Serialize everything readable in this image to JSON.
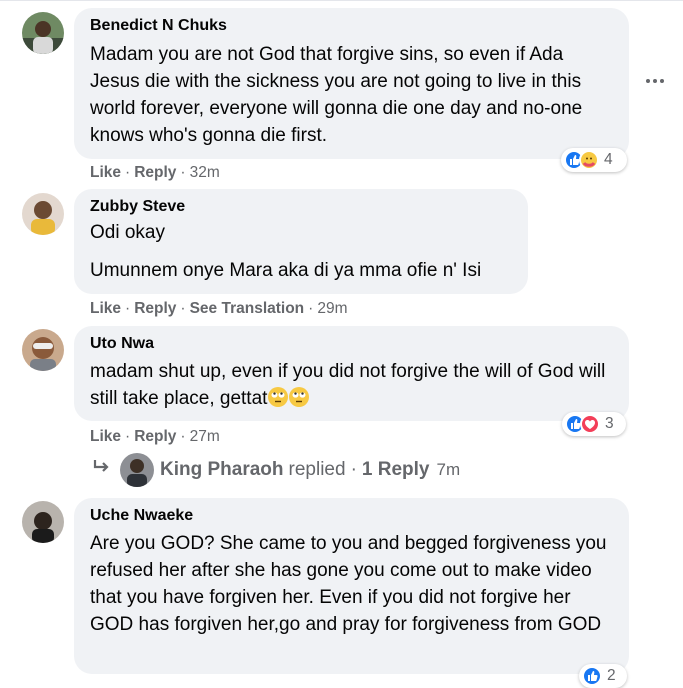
{
  "comments": [
    {
      "author": "Benedict N Chuks",
      "text": "Madam you are not God that forgive sins, so even if Ada Jesus die with the sickness you are not going to live in this world forever, everyone will gonna die one day and no-one knows who's gonna die first.",
      "actions": {
        "like": "Like",
        "reply": "Reply",
        "time": "32m"
      },
      "reactions": {
        "icons": [
          "like-icon",
          "care-icon"
        ],
        "count": "4"
      }
    },
    {
      "author": "Zubby Steve",
      "line1": "Odi okay",
      "line2": "Umunnem onye Mara aka di ya mma ofie n' Isi",
      "actions": {
        "like": "Like",
        "reply": "Reply",
        "translation": "See Translation",
        "time": "29m"
      }
    },
    {
      "author": "Uto Nwa",
      "text": "madam shut up, even if you did not forgive the will of God will still take place, gettat",
      "emojis": [
        "rolling-eyes-icon",
        "rolling-eyes-icon"
      ],
      "actions": {
        "like": "Like",
        "reply": "Reply",
        "time": "27m"
      },
      "reactions": {
        "icons": [
          "like-icon",
          "love-icon"
        ],
        "count": "3"
      },
      "reply_summary": {
        "name": "King Pharaoh",
        "verb": "replied",
        "link": "1 Reply",
        "time": "7m"
      }
    },
    {
      "author": "Uche Nwaeke",
      "text": "Are you GOD? She came to you and begged forgiveness you refused her after she has gone you come out to make video that you have forgiven her. Even if you did not forgive her GOD has forgiven her,go and pray for forgiveness from GOD",
      "reactions": {
        "icons": [
          "like-icon"
        ],
        "count": "2"
      }
    }
  ],
  "colors": {
    "bubble": "#f0f2f5",
    "secondary_text": "#65676b",
    "like_blue": "#1877f2",
    "love_red": "#f33e58",
    "emoji_yellow": "#f7c943"
  }
}
